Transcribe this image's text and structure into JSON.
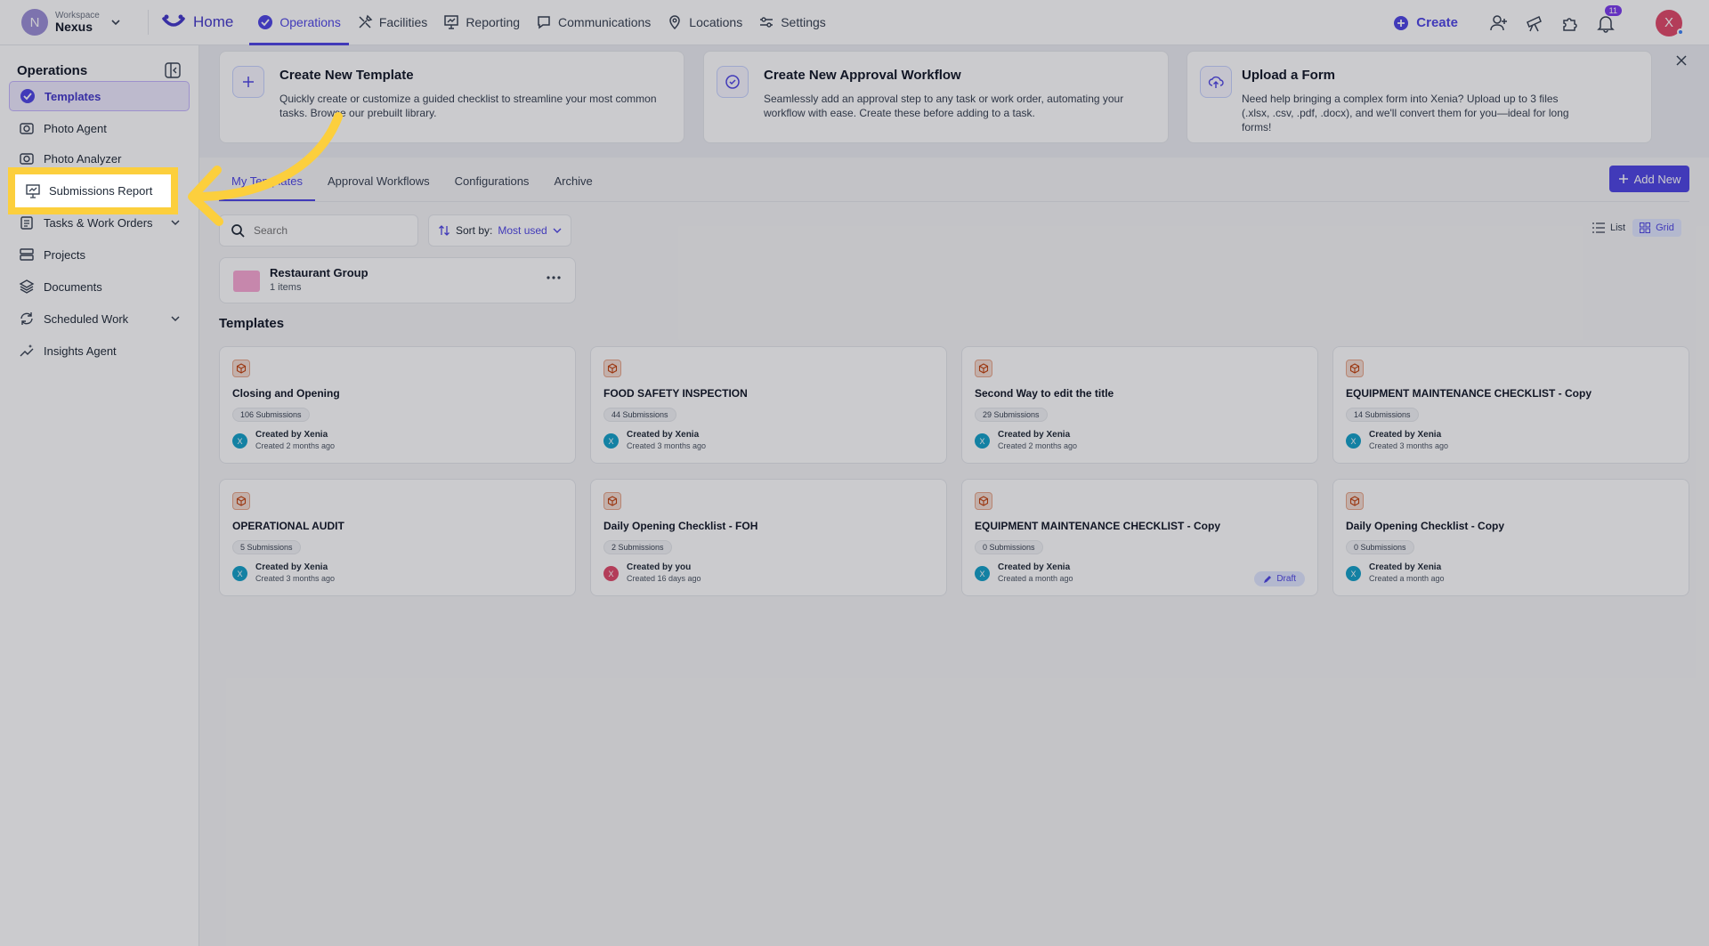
{
  "workspace": {
    "label": "Workspace",
    "name": "Nexus",
    "initial": "N"
  },
  "nav": {
    "home": "Home",
    "items": [
      "Operations",
      "Facilities",
      "Reporting",
      "Communications",
      "Locations",
      "Settings"
    ],
    "create": "Create",
    "notifications": "11",
    "user_initial": "X"
  },
  "sidebar": {
    "title": "Operations",
    "items": [
      {
        "label": "Templates"
      },
      {
        "label": "Photo Agent"
      },
      {
        "label": "Photo Analyzer"
      },
      {
        "label": "Submissions Report"
      },
      {
        "label": "Tasks & Work Orders"
      },
      {
        "label": "Projects"
      },
      {
        "label": "Documents"
      },
      {
        "label": "Scheduled Work"
      },
      {
        "label": "Insights Agent"
      }
    ]
  },
  "banner": {
    "cards": [
      {
        "title": "Create New Template",
        "desc": "Quickly create or customize a guided checklist to streamline your most common tasks. Browse our prebuilt library."
      },
      {
        "title": "Create New Approval Workflow",
        "desc": "Seamlessly add an approval step to any task or work order, automating your workflow with ease. Create these before adding to a task."
      },
      {
        "title": "Upload a Form",
        "desc": "Need help bringing a complex form into Xenia? Upload up to 3 files (.xlsx, .csv, .pdf, .docx), and we'll convert them for you—ideal for long forms!"
      }
    ]
  },
  "tabs": [
    "My Templates",
    "Approval Workflows",
    "Configurations",
    "Archive"
  ],
  "add_new": "Add New",
  "search": {
    "placeholder": "Search"
  },
  "sort": {
    "label": "Sort by:",
    "value": "Most used"
  },
  "view": {
    "list": "List",
    "grid": "Grid"
  },
  "folder": {
    "name": "Restaurant Group",
    "count": "1 items"
  },
  "templates_title": "Templates",
  "templates": [
    {
      "title": "Closing and Opening",
      "subs": "106 Submissions",
      "by": "Created by Xenia",
      "when": "Created 2 months ago",
      "initial": "X",
      "color": "#14a0c8"
    },
    {
      "title": "FOOD SAFETY INSPECTION",
      "subs": "44 Submissions",
      "by": "Created by Xenia",
      "when": "Created 3 months ago",
      "initial": "X",
      "color": "#14a0c8"
    },
    {
      "title": "Second Way to edit the title",
      "subs": "29 Submissions",
      "by": "Created by Xenia",
      "when": "Created 2 months ago",
      "initial": "X",
      "color": "#14a0c8"
    },
    {
      "title": "EQUIPMENT MAINTENANCE CHECKLIST - Copy",
      "subs": "14 Submissions",
      "by": "Created by Xenia",
      "when": "Created 3 months ago",
      "initial": "X",
      "color": "#14a0c8"
    },
    {
      "title": "OPERATIONAL AUDIT",
      "subs": "5 Submissions",
      "by": "Created by Xenia",
      "when": "Created 3 months ago",
      "initial": "X",
      "color": "#14a0c8"
    },
    {
      "title": "Daily Opening Checklist - FOH",
      "subs": "2 Submissions",
      "by": "Created by you",
      "when": "Created 16 days ago",
      "initial": "X",
      "color": "#e14a6a"
    },
    {
      "title": "EQUIPMENT MAINTENANCE CHECKLIST - Copy",
      "subs": "0 Submissions",
      "by": "Created by Xenia",
      "when": "Created a month ago",
      "initial": "X",
      "color": "#14a0c8",
      "draft": "Draft"
    },
    {
      "title": "Daily Opening Checklist - Copy",
      "subs": "0 Submissions",
      "by": "Created by Xenia",
      "when": "Created a month ago",
      "initial": "X",
      "color": "#14a0c8"
    }
  ],
  "colors": {
    "accent": "#4f46e5",
    "highlight": "#fccf3d"
  }
}
